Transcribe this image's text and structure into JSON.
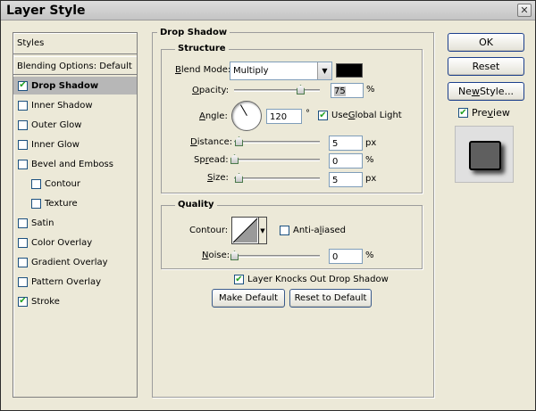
{
  "window": {
    "title": "Layer Style"
  },
  "styles_list": {
    "header": "Styles",
    "blending": "Blending Options: Default",
    "items": [
      {
        "label": "Drop Shadow",
        "checked": true,
        "selected": true,
        "indent": false
      },
      {
        "label": "Inner Shadow",
        "checked": false,
        "selected": false,
        "indent": false
      },
      {
        "label": "Outer Glow",
        "checked": false,
        "selected": false,
        "indent": false
      },
      {
        "label": "Inner Glow",
        "checked": false,
        "selected": false,
        "indent": false
      },
      {
        "label": "Bevel and Emboss",
        "checked": false,
        "selected": false,
        "indent": false
      },
      {
        "label": "Contour",
        "checked": false,
        "selected": false,
        "indent": true
      },
      {
        "label": "Texture",
        "checked": false,
        "selected": false,
        "indent": true
      },
      {
        "label": "Satin",
        "checked": false,
        "selected": false,
        "indent": false
      },
      {
        "label": "Color Overlay",
        "checked": false,
        "selected": false,
        "indent": false
      },
      {
        "label": "Gradient Overlay",
        "checked": false,
        "selected": false,
        "indent": false
      },
      {
        "label": "Pattern Overlay",
        "checked": false,
        "selected": false,
        "indent": false
      },
      {
        "label": "Stroke",
        "checked": true,
        "selected": false,
        "indent": false
      }
    ]
  },
  "drop_shadow": {
    "group_title": "Drop Shadow",
    "structure": {
      "title": "Structure",
      "blend_mode_label_u": "B",
      "blend_mode_label_rest": "lend Mode:",
      "blend_mode_value": "Multiply",
      "shadow_color": "#000000",
      "opacity_label_u": "O",
      "opacity_label_rest": "pacity:",
      "opacity_value": "75",
      "opacity_unit": "%",
      "angle_label_u": "A",
      "angle_label_rest": "ngle:",
      "angle_value": "120",
      "angle_unit": "°",
      "use_global_light_label_u": "G",
      "use_global_light_label_pre": "Use ",
      "use_global_light_label_rest": "lobal Light",
      "use_global_light_checked": true,
      "distance_label_u": "D",
      "distance_label_rest": "istance:",
      "distance_value": "5",
      "distance_unit": "px",
      "spread_label_pre": "Sp",
      "spread_label_u": "r",
      "spread_label_rest": "ead:",
      "spread_value": "0",
      "spread_unit": "%",
      "size_label_u": "S",
      "size_label_rest": "ize:",
      "size_value": "5",
      "size_unit": "px"
    },
    "quality": {
      "title": "Quality",
      "contour_label": "Contour:",
      "anti_aliased_label_pre": "Anti-a",
      "anti_aliased_label_u": "l",
      "anti_aliased_label_rest": "iased",
      "anti_aliased_checked": false,
      "noise_label_u": "N",
      "noise_label_rest": "oise:",
      "noise_value": "0",
      "noise_unit": "%"
    },
    "knocks_out_label": "Layer Knocks Out Drop Shadow",
    "knocks_out_checked": true,
    "make_default_label": "Make Default",
    "reset_default_label": "Reset to Default"
  },
  "buttons": {
    "ok": "OK",
    "reset": "Reset",
    "new_style_pre": "Ne",
    "new_style_u": "w",
    "new_style_rest": " Style...",
    "preview_pre": "Pre",
    "preview_u": "v",
    "preview_rest": "iew",
    "preview_checked": true
  },
  "icons": {
    "close": "close-icon",
    "check": "check-icon",
    "dropdown": "chevron-down-icon"
  }
}
